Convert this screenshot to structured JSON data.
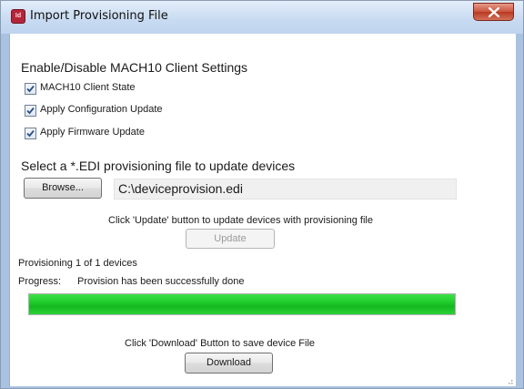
{
  "window": {
    "title": "Import Provisioning File",
    "app_icon_text": "Id"
  },
  "settings": {
    "heading": "Enable/Disable MACH10 Client Settings",
    "checkboxes": [
      {
        "label": "MACH10 Client State",
        "checked": true
      },
      {
        "label": "Apply Configuration Update",
        "checked": true
      },
      {
        "label": "Apply Firmware Update",
        "checked": true
      }
    ]
  },
  "file": {
    "heading": "Select a *.EDI provisioning file to update devices",
    "browse_label": "Browse...",
    "path_value": "C:\\deviceprovision.edi"
  },
  "update": {
    "hint": "Click 'Update' button to update devices with provisioning file",
    "button_label": "Update",
    "enabled": false
  },
  "status": {
    "provisioning_text": "Provisioning 1 of 1 devices",
    "progress_label": "Progress:",
    "progress_message": "Provision has been successfully done",
    "progress_fraction": 1.0,
    "progress_color": "#1fcc2b"
  },
  "download": {
    "hint": "Click 'Download' Button to save device File",
    "button_label": "Download"
  }
}
